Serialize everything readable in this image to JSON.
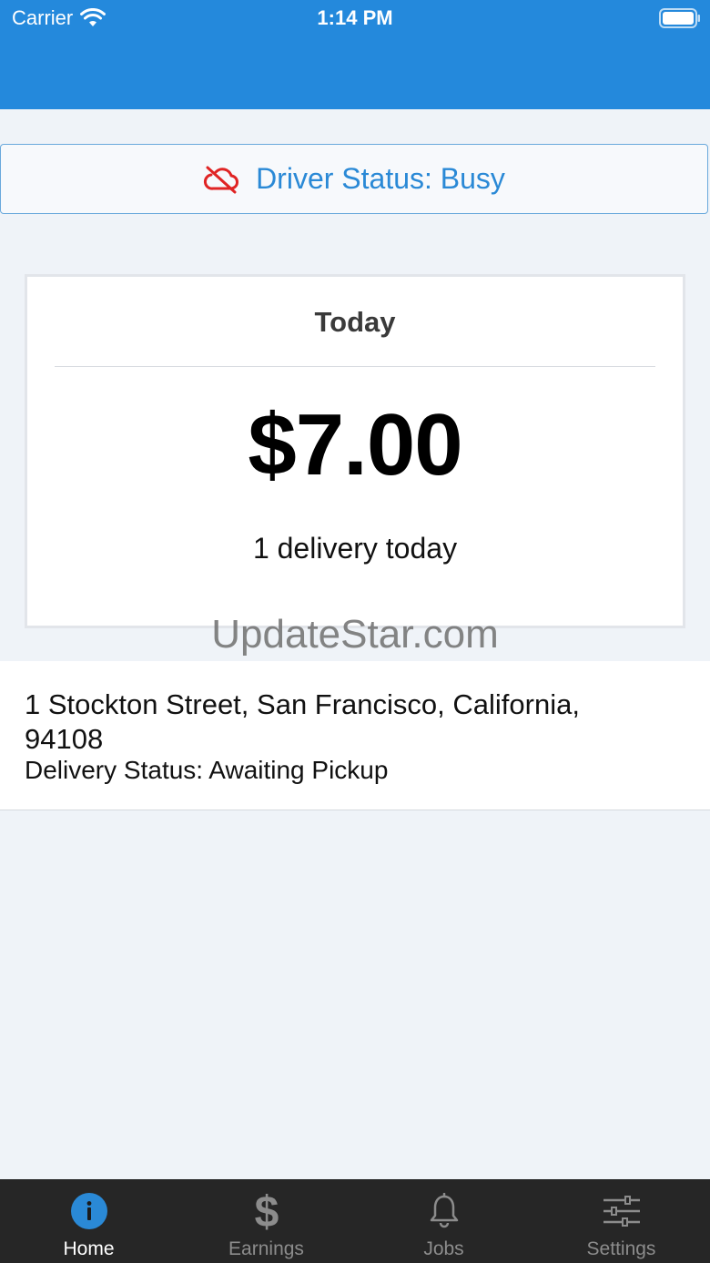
{
  "status_bar": {
    "carrier": "Carrier",
    "time": "1:14 PM"
  },
  "driver_status": {
    "label": "Driver Status: Busy",
    "icon": "cloud-off-icon",
    "icon_color": "#e02424"
  },
  "today": {
    "title": "Today",
    "amount": "$7.00",
    "deliveries": "1 delivery today"
  },
  "watermark": "UpdateStar.com",
  "delivery": {
    "address": "1 Stockton Street, San Francisco, California, 94108",
    "status": "Delivery Status: Awaiting Pickup"
  },
  "tabs": [
    {
      "label": "Home",
      "icon": "info-icon",
      "active": true
    },
    {
      "label": "Earnings",
      "icon": "dollar-icon",
      "active": false
    },
    {
      "label": "Jobs",
      "icon": "bell-icon",
      "active": false
    },
    {
      "label": "Settings",
      "icon": "sliders-icon",
      "active": false
    }
  ],
  "colors": {
    "header": "#2489dc",
    "accent": "#2a89d6",
    "tab_bar": "#262626",
    "background": "#eff3f8"
  }
}
